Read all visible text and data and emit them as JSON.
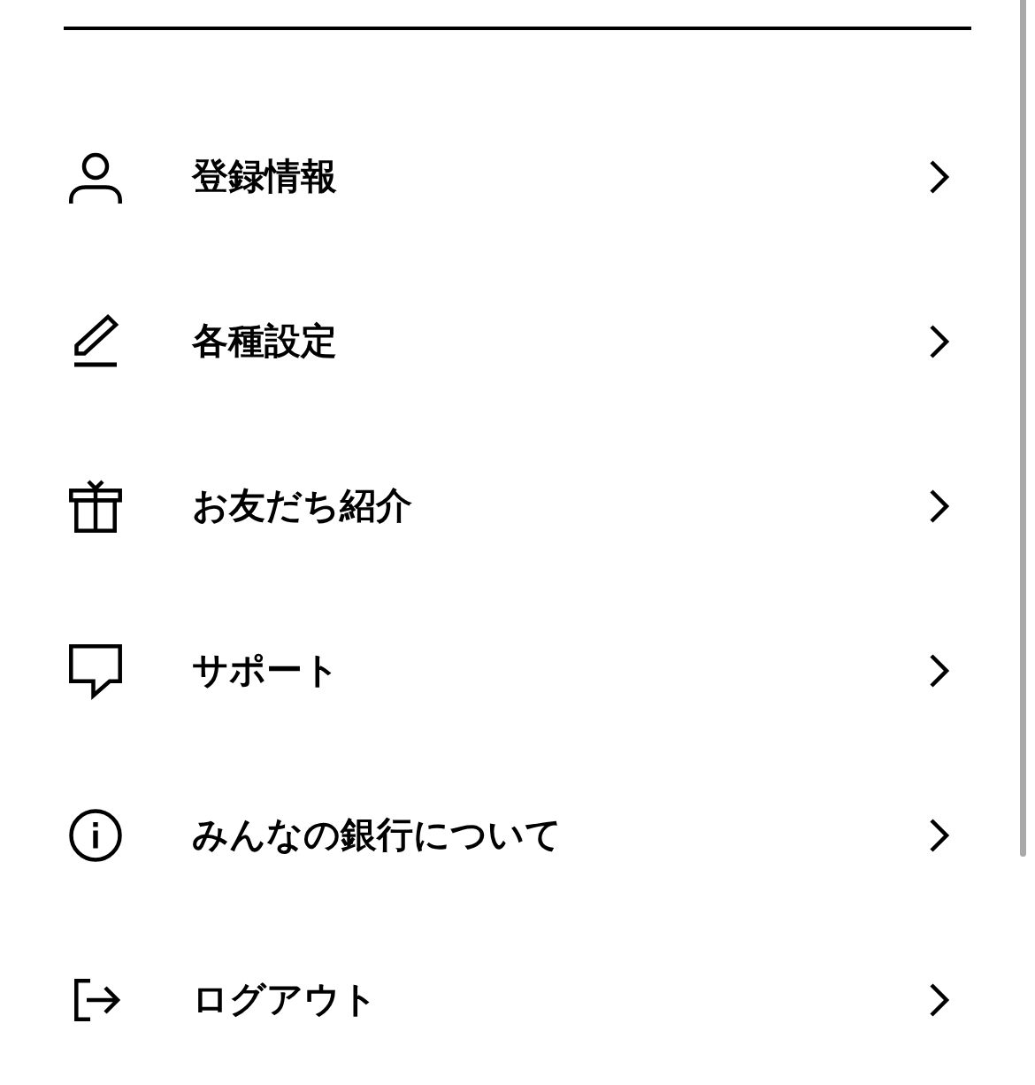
{
  "menu": {
    "items": [
      {
        "kind": "person",
        "label": "登録情報"
      },
      {
        "kind": "pencil",
        "label": "各種設定"
      },
      {
        "kind": "gift",
        "label": "お友だち紹介"
      },
      {
        "kind": "speech",
        "label": "サポート"
      },
      {
        "kind": "info",
        "label": "みんなの銀行について"
      },
      {
        "kind": "logout",
        "label": "ログアウト"
      }
    ]
  }
}
